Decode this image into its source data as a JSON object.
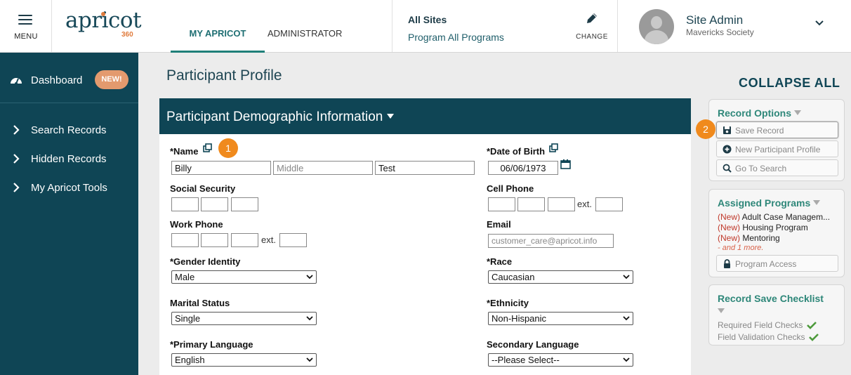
{
  "header": {
    "menu_label": "MENU",
    "logo_word": "apricot",
    "logo_number": "360",
    "tabs": [
      {
        "label": "MY APRICOT",
        "active": true
      },
      {
        "label": "ADMINISTRATOR",
        "active": false
      }
    ],
    "site": "All Sites",
    "program": "Program All Programs",
    "change_label": "CHANGE",
    "user_name": "Site Admin",
    "user_org": "Mavericks Society"
  },
  "sidebar": {
    "dashboard": {
      "label": "Dashboard",
      "badge": "NEW!"
    },
    "items": [
      {
        "label": "Search Records"
      },
      {
        "label": "Hidden Records"
      },
      {
        "label": "My Apricot Tools"
      }
    ]
  },
  "main": {
    "page_title": "Participant Profile",
    "section_title": "Participant Demographic Information",
    "step1": "1",
    "fields": {
      "name": {
        "label": "*Name",
        "first": "Billy",
        "middle_placeholder": "Middle",
        "last": "Test"
      },
      "dob": {
        "label": "*Date of Birth",
        "value": "06/06/1973"
      },
      "ssn": {
        "label": "Social Security"
      },
      "cell_phone": {
        "label": "Cell Phone",
        "ext": "ext."
      },
      "work_phone": {
        "label": "Work Phone",
        "ext": "ext."
      },
      "email": {
        "label": "Email",
        "placeholder": "customer_care@apricot.info"
      },
      "gender": {
        "label": "*Gender Identity",
        "value": "Male"
      },
      "race": {
        "label": "*Race",
        "value": "Caucasian"
      },
      "marital": {
        "label": "Marital Status",
        "value": "Single"
      },
      "ethnicity": {
        "label": "*Ethnicity",
        "value": "Non-Hispanic"
      },
      "primary_language": {
        "label": "*Primary Language",
        "value": "English"
      },
      "secondary_language": {
        "label": "Secondary Language",
        "value": "--Please Select--"
      }
    }
  },
  "right": {
    "collapse_all": "COLLAPSE ALL",
    "step2": "2",
    "record_options": {
      "title": "Record Options",
      "save": "Save Record",
      "new_profile": "New Participant Profile",
      "search": "Go To Search"
    },
    "assigned_programs": {
      "title": "Assigned Programs",
      "new_tag": "(New)",
      "programs": [
        "Adult Case Managem...",
        "Housing Program",
        "Mentoring"
      ],
      "more": "- and 1 more.",
      "access": "Program Access"
    },
    "checklist": {
      "title": "Record Save Checklist",
      "items": [
        "Required Field Checks",
        "Field Validation Checks"
      ]
    }
  },
  "colors": {
    "navy": "#0f4555",
    "teal": "#2e8779",
    "orange": "#f08a1d",
    "badge": "#e39a6e",
    "check": "#4d9a3b",
    "new_red": "#c0392b"
  }
}
